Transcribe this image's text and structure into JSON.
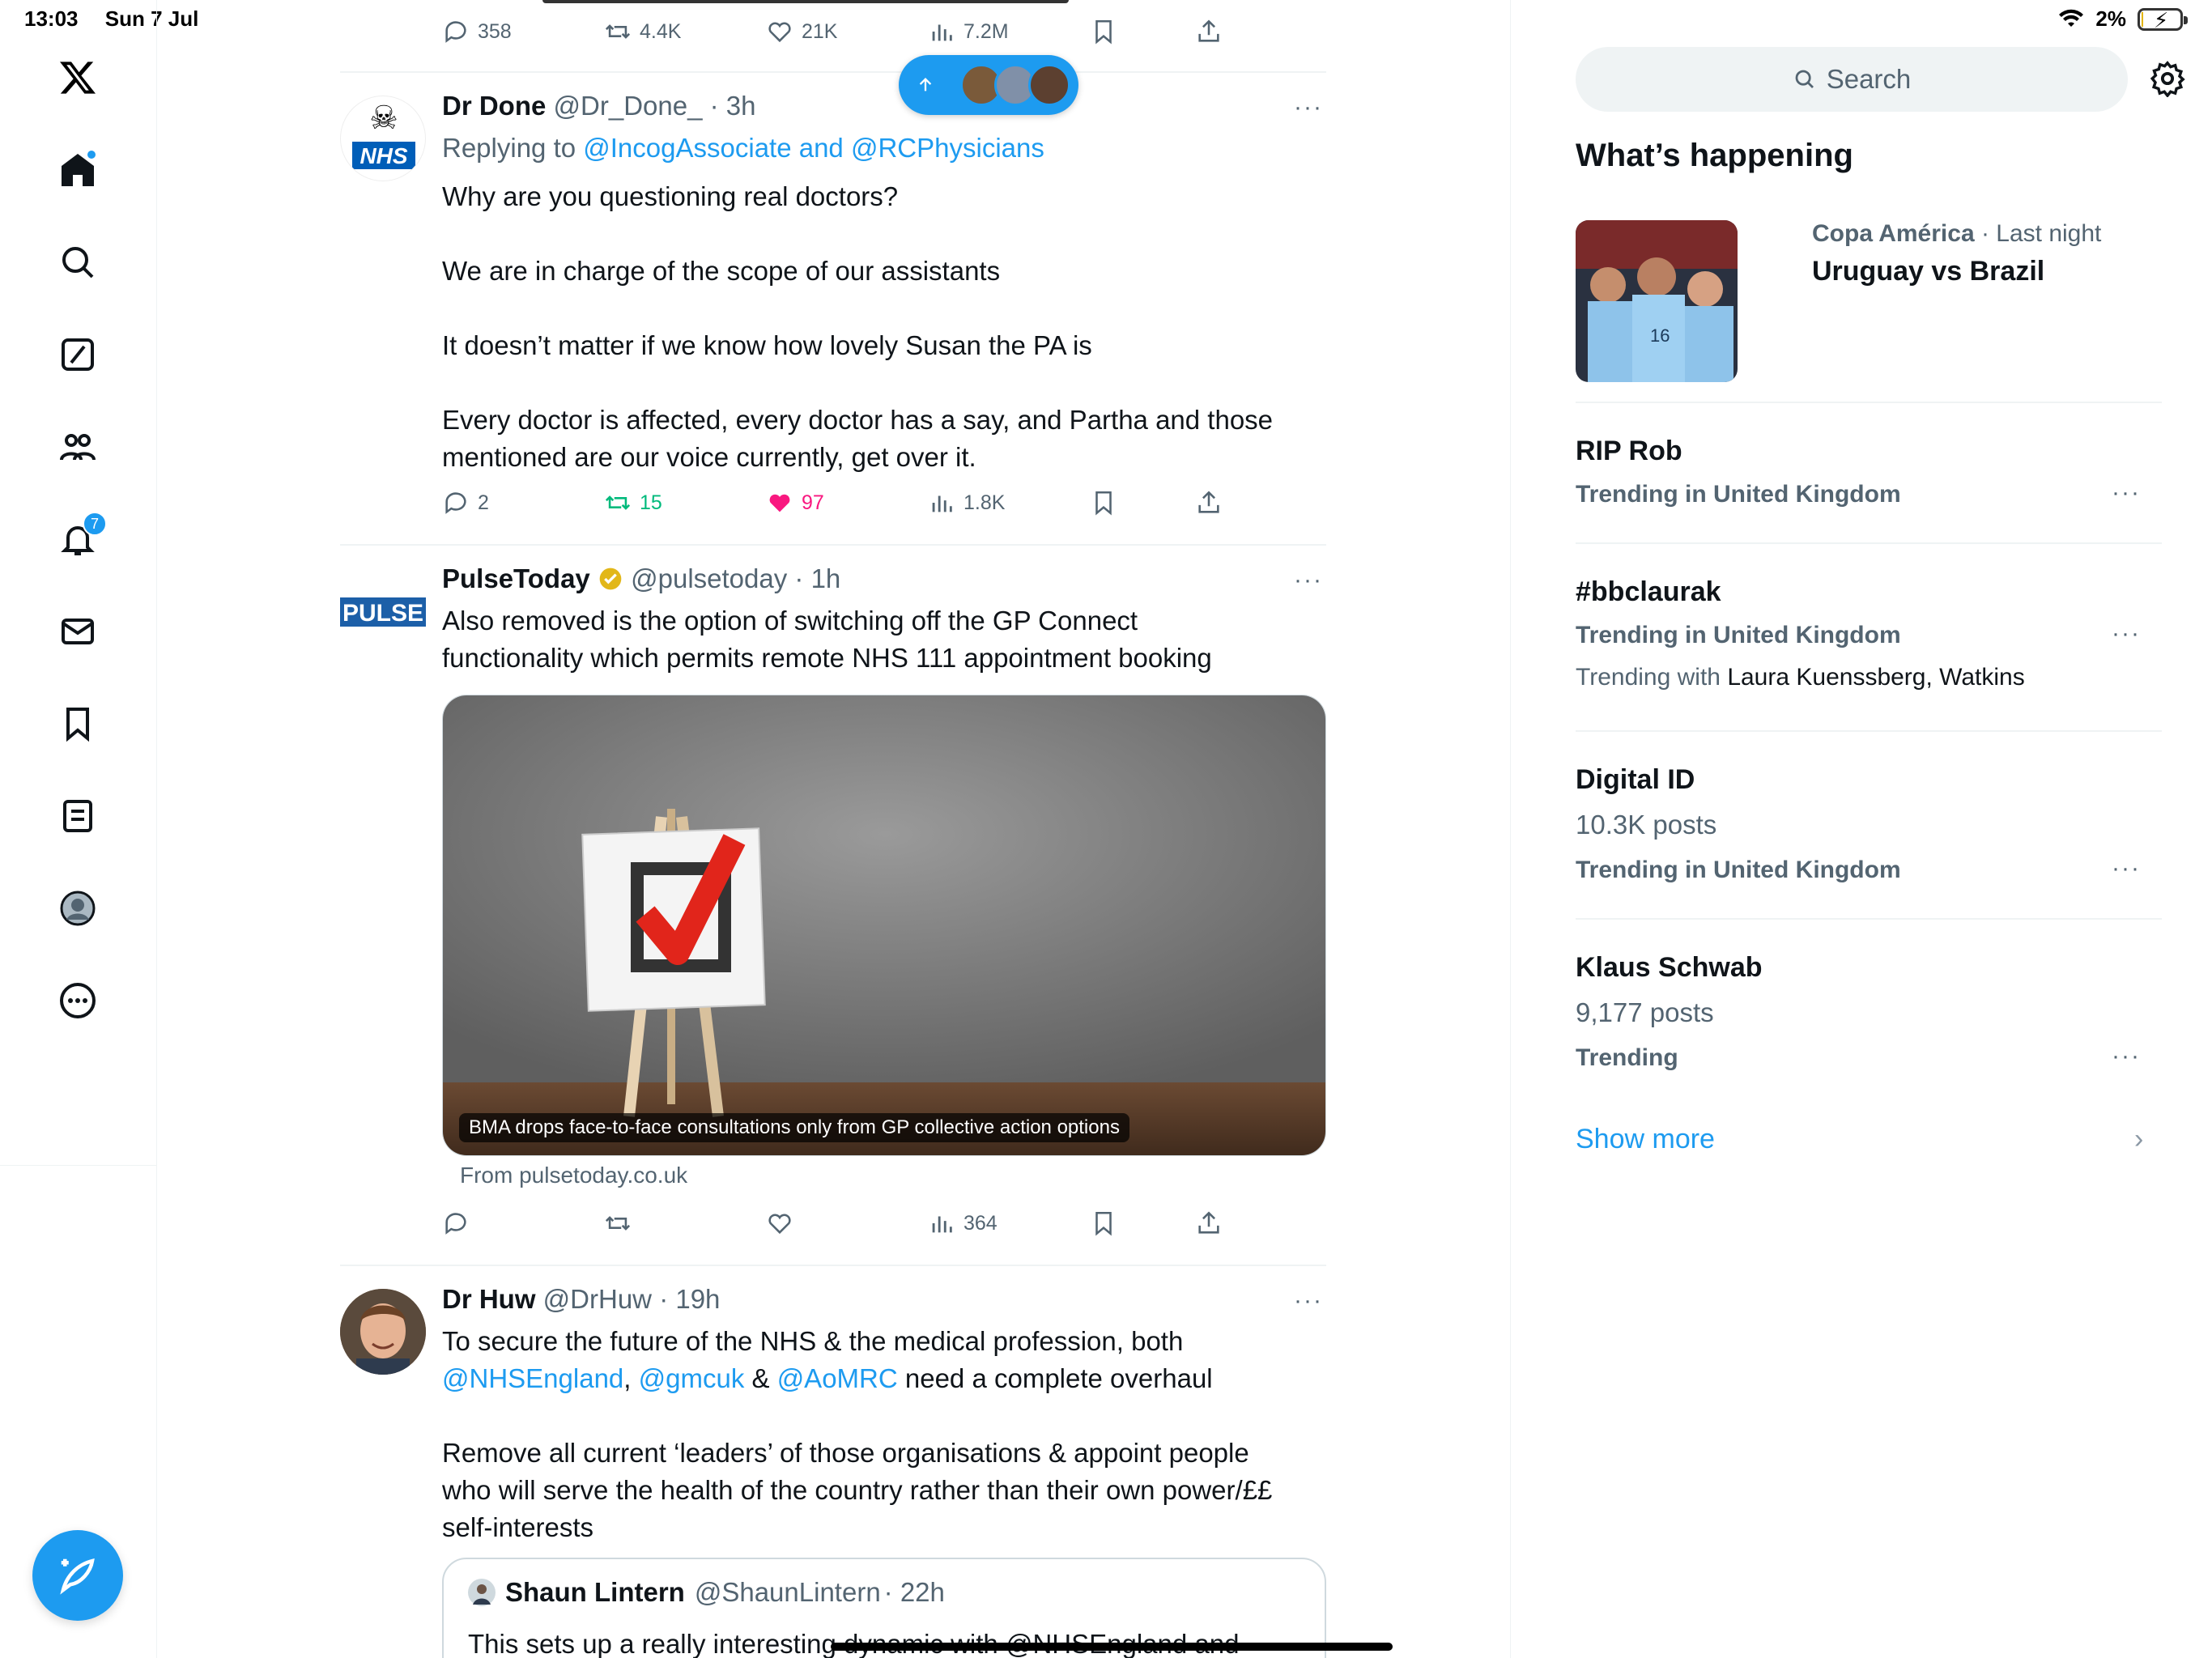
{
  "status_bar": {
    "time": "13:03",
    "date": "Sun 7 Jul",
    "battery": "2%",
    "battery_level": 0.02
  },
  "colors": {
    "accent": "#1d9bf0",
    "like": "#f91880",
    "retweet": "#00ba7c",
    "text": "#0f1419",
    "muted": "#536471"
  },
  "nav": {
    "items": [
      "x-logo-icon",
      "home-icon",
      "search-icon",
      "grok-icon",
      "communities-icon",
      "notifications-icon",
      "messages-icon",
      "bookmarks-icon",
      "lists-icon",
      "profile-icon",
      "more-icon"
    ],
    "notifications_badge": "7",
    "compose_icon": "compose-icon"
  },
  "feed": {
    "top_actions": {
      "replies": "358",
      "retweets": "4.4K",
      "likes": "21K",
      "views": "7.2M"
    },
    "tweets": [
      {
        "name": "Dr Done",
        "handle": "@Dr_Done_",
        "time": "· 3h",
        "replying_label": "Replying to ",
        "replying_to": "@IncogAssociate and @RCPhysicians",
        "avatar_text": "NHS",
        "text": "Why are you questioning real doctors?\n\nWe are in charge of the scope of our assistants\n\nIt doesn’t matter if we know how lovely Susan the PA is\n\nEvery doctor is affected, every doctor has a say, and Partha and those\nmentioned are our voice currently, get over it.",
        "replies": "2",
        "retweets": "15",
        "likes": "97",
        "views": "1.8K"
      },
      {
        "name": "PulseToday",
        "handle": "@pulsetoday",
        "time": "· 1h",
        "avatar_text": "PULSE",
        "text": "Also removed is the option of switching off the GP Connect\nfunctionality which permits remote NHS 111 appointment booking",
        "card_caption": "BMA drops face-to-face consultations only from GP collective action options",
        "card_source": "From pulsetoday.co.uk",
        "views": "364"
      },
      {
        "name": "Dr Huw",
        "handle": "@DrHuw",
        "time": "· 19h",
        "text_line1": "To secure the future of the NHS & the medical profession, both",
        "mention1": "@NHSEngland",
        "sep1": ", ",
        "mention2": "@gmcuk",
        "sep2": " & ",
        "mention3": "@AoMRC",
        "text_line2_tail": " need a complete overhaul",
        "text_para2": "Remove all current ‘leaders’ of those organisations & appoint people\nwho will serve the health of the country rather than their own power/££\nself-interests",
        "quote": {
          "name": "Shaun Lintern",
          "handle": "@ShaunLintern",
          "time": "· 22h",
          "text": "This sets up a really interesting dynamic with @NHSEngland and"
        }
      }
    ]
  },
  "sidebar": {
    "search_placeholder": "Search",
    "section_title": "What’s happening",
    "featured": {
      "category": "Copa América",
      "when": " · Last night",
      "title": "Uruguay vs Brazil"
    },
    "trends": [
      {
        "name": "RIP Rob",
        "meta": "Trending in United Kingdom"
      },
      {
        "name": "#bbclaurak",
        "meta": "Trending in United Kingdom",
        "with_label": "Trending with ",
        "with": "Laura Kuenssberg, Watkins"
      },
      {
        "name": "Digital ID",
        "posts": "10.3K posts",
        "meta": "Trending in United Kingdom"
      },
      {
        "name": "Klaus Schwab",
        "posts": "9,177 posts",
        "meta": "Trending"
      }
    ],
    "show_more": "Show more"
  }
}
